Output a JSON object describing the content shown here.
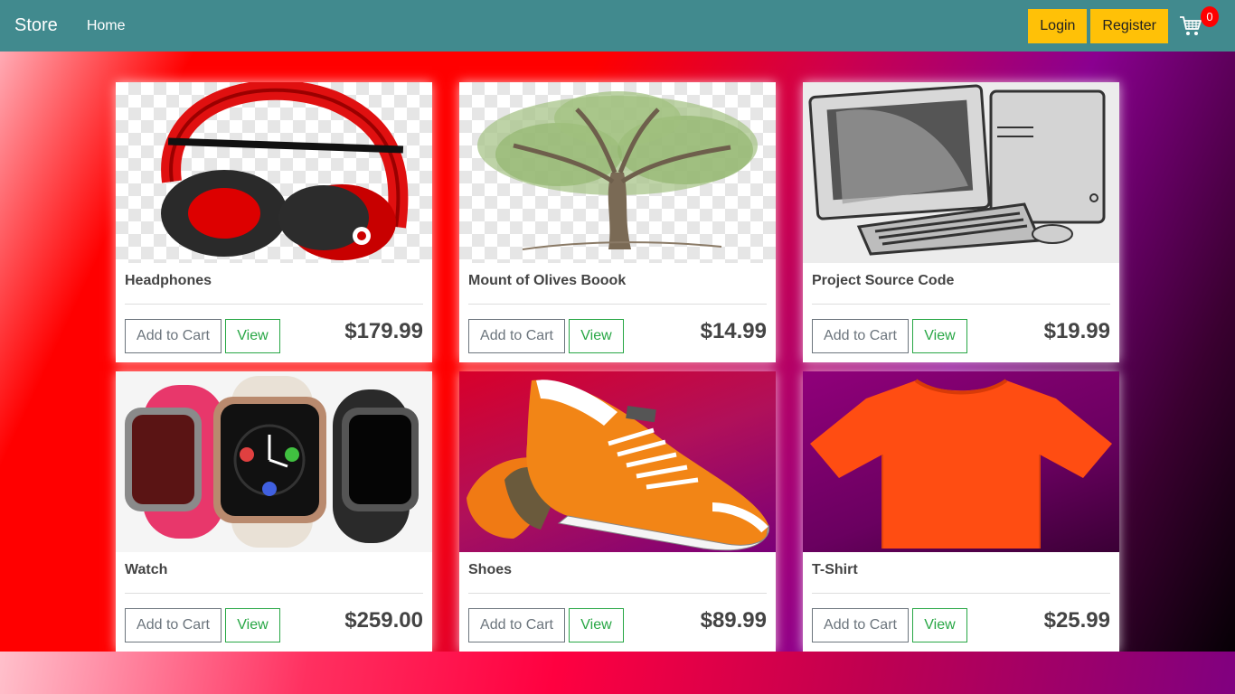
{
  "navbar": {
    "brand": "Store",
    "home": "Home",
    "login": "Login",
    "register": "Register",
    "cart_icon": "shopping-cart-icon",
    "cart_count": "0"
  },
  "products": [
    {
      "name": "Headphones",
      "price": "$179.99",
      "image": "headphones-image"
    },
    {
      "name": "Mount of Olives Boook",
      "price": "$14.99",
      "image": "tree-image"
    },
    {
      "name": "Project Source Code",
      "price": "$19.99",
      "image": "computer-image"
    },
    {
      "name": "Watch",
      "price": "$259.00",
      "image": "watches-image"
    },
    {
      "name": "Shoes",
      "price": "$89.99",
      "image": "sneakers-image"
    },
    {
      "name": "T-Shirt",
      "price": "$25.99",
      "image": "tshirt-image"
    }
  ],
  "labels": {
    "add_to_cart": "Add to Cart",
    "view": "View"
  },
  "colors": {
    "navbar": "#418a8e",
    "auth_buttons": "#ffc107",
    "badge": "#ff0000",
    "view_outline": "#28a745",
    "add_outline": "#6c757d"
  }
}
